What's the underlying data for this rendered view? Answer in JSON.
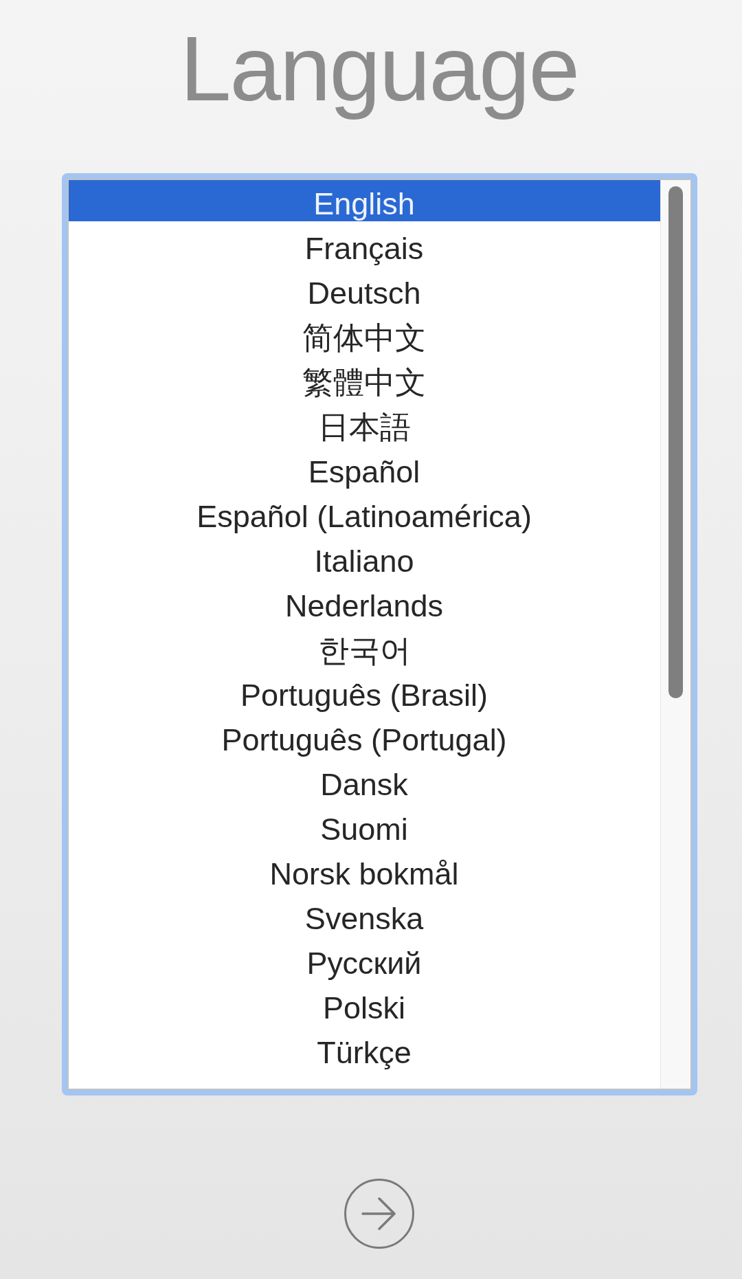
{
  "title": "Language",
  "languages": [
    {
      "label": "English",
      "selected": true
    },
    {
      "label": "Français",
      "selected": false
    },
    {
      "label": "Deutsch",
      "selected": false
    },
    {
      "label": "简体中文",
      "selected": false
    },
    {
      "label": "繁體中文",
      "selected": false
    },
    {
      "label": "日本語",
      "selected": false
    },
    {
      "label": "Español",
      "selected": false
    },
    {
      "label": "Español (Latinoamérica)",
      "selected": false
    },
    {
      "label": "Italiano",
      "selected": false
    },
    {
      "label": "Nederlands",
      "selected": false
    },
    {
      "label": "한국어",
      "selected": false
    },
    {
      "label": "Português (Brasil)",
      "selected": false
    },
    {
      "label": "Português (Portugal)",
      "selected": false
    },
    {
      "label": "Dansk",
      "selected": false
    },
    {
      "label": "Suomi",
      "selected": false
    },
    {
      "label": "Norsk bokmål",
      "selected": false
    },
    {
      "label": "Svenska",
      "selected": false
    },
    {
      "label": "Русский",
      "selected": false
    },
    {
      "label": "Polski",
      "selected": false
    },
    {
      "label": "Türkçe",
      "selected": false
    }
  ]
}
